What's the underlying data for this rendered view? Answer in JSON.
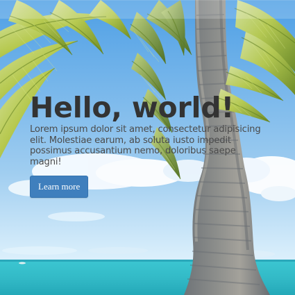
{
  "hero": {
    "title": "Hello, world!",
    "body": "Lorem ipsum dolor sit amet, consectetur adipisicing elit. Molestiae earum, ab soluta iusto impedit possimus accusantium nemo, doloribus saepe magni!",
    "button_label": "Learn more"
  },
  "colors": {
    "button": "#3f7fbd",
    "title": "#333333",
    "body": "#4b4b4b",
    "sky": "#8ec3ea",
    "sea": "#35c4c9"
  },
  "icons": {
    "background": "palm-tree-beach-image"
  }
}
